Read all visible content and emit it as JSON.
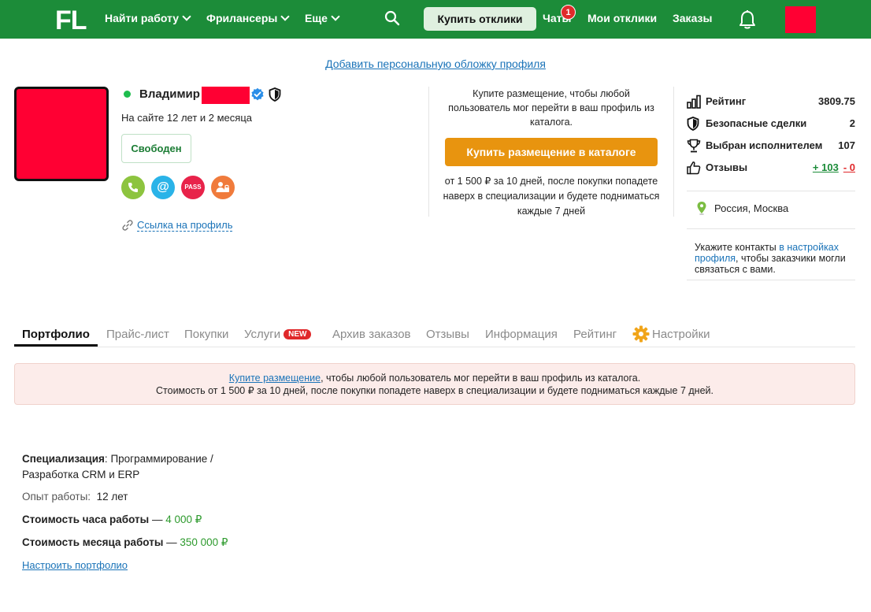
{
  "header": {
    "logo": "FL",
    "nav": [
      {
        "label": "Найти работу",
        "has_chevron": true
      },
      {
        "label": "Фрилансеры",
        "has_chevron": true
      },
      {
        "label": "Еще",
        "has_chevron": true
      }
    ],
    "search_icon": "search-icon",
    "buy_responses_label": "Купить отклики",
    "chats_label": "Чаты",
    "chats_badge": "1",
    "my_responses_label": "Мои отклики",
    "orders_label": "Заказы",
    "bell_icon": "bell-icon",
    "avatar_color": "#ff0033",
    "bg_color": "#1c8c39"
  },
  "cover_link": "Добавить персональную обложку профиля",
  "profile": {
    "name": "Владимир",
    "online": true,
    "since": "На сайте 12 лет и 2 месяца",
    "status": "Свободен",
    "contact_icons": [
      {
        "name": "phone-icon",
        "glyph": "✆",
        "color": "#8dc43f"
      },
      {
        "name": "email-icon",
        "glyph": "@",
        "color": "#2ab3e8"
      },
      {
        "name": "pass-icon",
        "glyph": "PASS",
        "color": "#e8234a"
      },
      {
        "name": "verified-user-icon",
        "glyph": "",
        "color": "#f07b3c"
      }
    ],
    "profile_link": "Ссылка на профиль"
  },
  "promo": {
    "text": "Купите размещение, чтобы любой пользователь мог перейти в ваш профиль из каталога.",
    "button": "Купить размещение в каталоге",
    "sub": "от 1 500 ₽ за 10 дней, после покупки попадете наверх в специализации и будете подниматься каждые 7 дней"
  },
  "stats": {
    "rating_label": "Рейтинг",
    "rating_value": "3809.75",
    "safe_label": "Безопасные сделки",
    "safe_value": "2",
    "chosen_label": "Выбран исполнителем",
    "chosen_value": "107",
    "reviews_label": "Отзывы",
    "reviews_pos": "+ 103",
    "reviews_neg": "- 0",
    "location": "Россия, Москва",
    "contacts_prefix": "Укажите контакты ",
    "contacts_link": "в настройках профиля",
    "contacts_suffix": ", чтобы заказчики могли связаться с вами."
  },
  "tabs": [
    {
      "label": "Портфолио",
      "active": true
    },
    {
      "label": "Прайс-лист"
    },
    {
      "label": "Покупки"
    },
    {
      "label": "Услуги",
      "badge": "NEW"
    },
    {
      "label": "Архив заказов"
    },
    {
      "label": "Отзывы"
    },
    {
      "label": "Информация"
    },
    {
      "label": "Рейтинг"
    },
    {
      "label": "Настройки",
      "icon": "gear-icon"
    }
  ],
  "notice": {
    "link": "Купите размещение",
    "line1": ", чтобы любой пользователь мог перейти в ваш профиль из каталога.",
    "line2": "Стоимость от 1 500 ₽ за 10 дней, после покупки попадете наверх в специализации и будете подниматься каждые 7 дней."
  },
  "details": {
    "spec_label": "Специализация",
    "spec_value_1": "Программирование /",
    "spec_value_2": "Разработка CRM и ERP",
    "exp_label": "Опыт работы:",
    "exp_value": "12 лет",
    "hour_label": "Стоимость часа работы",
    "hour_value": "4 000 ₽",
    "month_label": "Стоимость месяца работы",
    "month_value": "350 000 ₽",
    "config_link": "Настроить портфолио"
  }
}
